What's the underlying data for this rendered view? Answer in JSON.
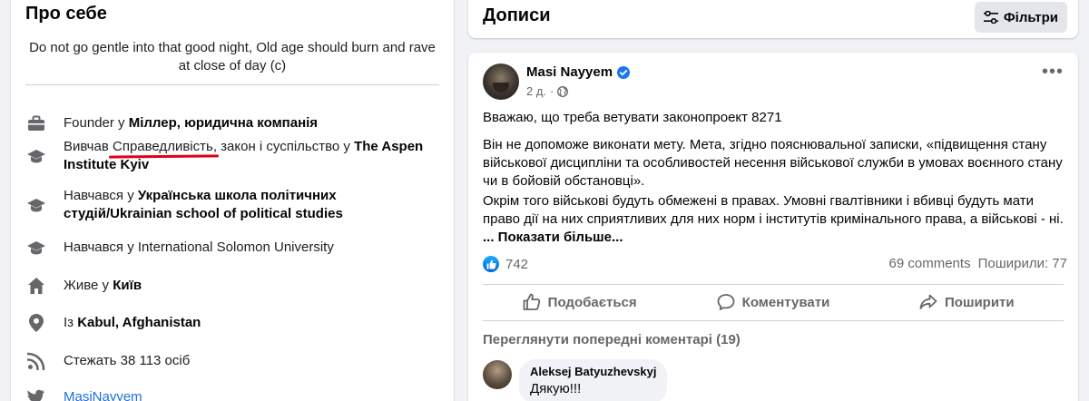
{
  "about": {
    "title": "Про себе",
    "bio": "Do not go gentle into that good night, Old age should burn and rave at close of day (c)",
    "work": {
      "prefix": "Founder у ",
      "place": "Міллер, юридична компанія"
    },
    "edu1": {
      "prefix": "Вивчав ",
      "underlined": "Справедливість",
      "middle": ", закон і суспільство у ",
      "place": "The Aspen Institute Kyiv"
    },
    "edu2": {
      "prefix": "Навчався у ",
      "place": "Українська школа політичних студій/Ukrainian school of political studies"
    },
    "edu3": {
      "prefix": "Навчався у ",
      "place": "International Solomon University"
    },
    "lives": {
      "prefix": "Живе у ",
      "place": "Київ"
    },
    "from": {
      "prefix": "Із ",
      "place": "Kabul, Afghanistan"
    },
    "followers": {
      "text": "Стежать 38 113 осіб"
    },
    "twitter": {
      "handle": "MasiNayyem"
    }
  },
  "posts": {
    "title": "Дописи",
    "filter_label": "Фільтри"
  },
  "post": {
    "author": "Masi Nayyem",
    "time": "2 д.",
    "p1": "Вважаю, що треба ветувати законопроект 8271",
    "p2": "Він не допоможе виконати мету. Мета, згідно пояснювальної записки, «підвищення стану військової дисципліни та особливостей несення військової служби в умовах воєнного стану чи в бойовій обстановці».",
    "p3": "Окрім того військові будуть обмежені в правах. Умовні гвалтівники і вбивці будуть мати право дії на них сприятливих для них норм і інститутів кримінального права, а військові - ні.",
    "see_more": "... Показати більше...",
    "reactions": "742",
    "comments": "69 comments",
    "shares": "Поширили: 77",
    "like_label": "Подобається",
    "comment_label": "Коментувати",
    "share_label": "Поширити",
    "prev_comments": "Переглянути попередні коментарі (19)",
    "comment": {
      "name": "Aleksej Batyuzhevskyj",
      "text": "Дякую!!!"
    }
  }
}
